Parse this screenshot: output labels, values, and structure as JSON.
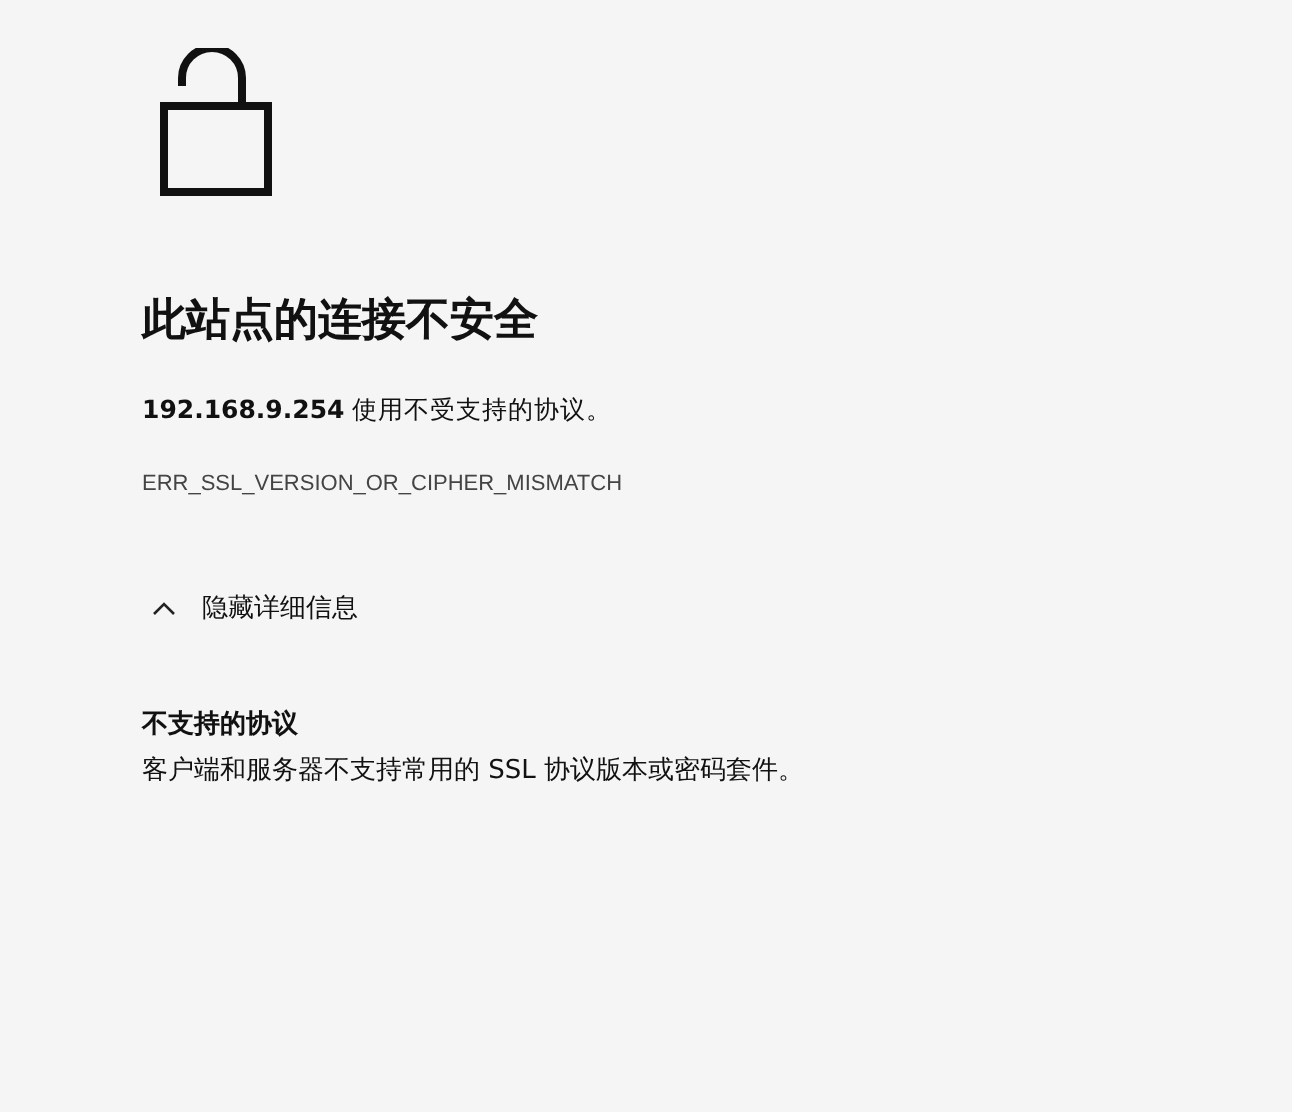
{
  "title": "此站点的连接不安全",
  "message": "**192.168.9.254** 使用不受支持的协议。",
  "error_code": "ERR_SSL_VERSION_OR_CIPHER_MISMATCH",
  "details_toggle": {
    "label": "隐藏详细信息",
    "expanded": true
  },
  "details": {
    "heading": "不支持的协议",
    "text": "客户端和服务器不支持常用的 SSL 协议版本或密码套件。"
  }
}
